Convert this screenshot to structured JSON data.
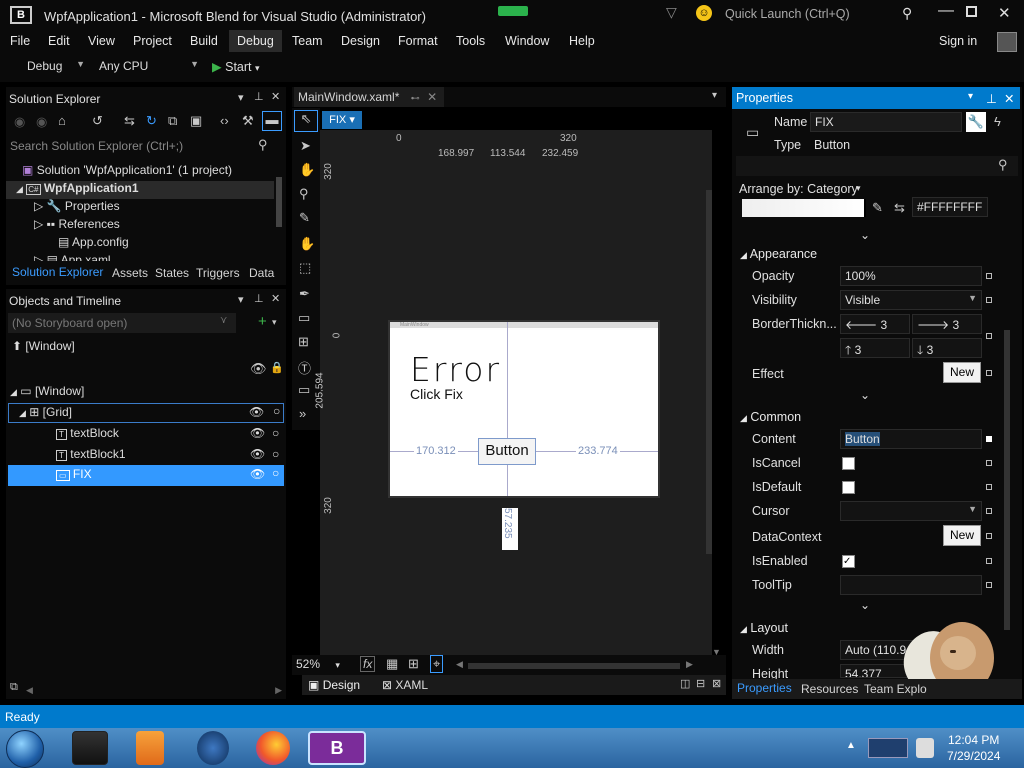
{
  "window": {
    "title": "WpfApplication1 - Microsoft Blend for Visual Studio (Administrator)",
    "quick_launch": "Quick Launch (Ctrl+Q)"
  },
  "menu": {
    "items": [
      "File",
      "Edit",
      "View",
      "Project",
      "Build",
      "Debug",
      "Team",
      "Design",
      "Format",
      "Tools",
      "Window",
      "Help"
    ],
    "sign_in": "Sign in"
  },
  "toolbar": {
    "config": "Debug",
    "platform": "Any CPU",
    "start": "Start"
  },
  "solution_explorer": {
    "title": "Solution Explorer",
    "search_placeholder": "Search Solution Explorer (Ctrl+;)",
    "items": [
      "Solution 'WpfApplication1' (1 project)",
      "WpfApplication1",
      "Properties",
      "References",
      "App.config",
      "App.xaml"
    ],
    "tabs": [
      "Solution Explorer",
      "Assets",
      "States",
      "Triggers",
      "Data"
    ]
  },
  "objects": {
    "title": "Objects and Timeline",
    "storyboard": "(No Storyboard open)",
    "window_root": "[Window]",
    "tree": [
      "[Window]",
      "[Grid]",
      "textBlock",
      "textBlock1",
      "FIX"
    ]
  },
  "document": {
    "tab": "MainWindow.xaml*",
    "fix_badge": "FIX",
    "ruler_top": [
      "0",
      "320"
    ],
    "ruler_left": [
      "320",
      "0",
      "320"
    ],
    "measures": {
      "m1": "168.997",
      "m2": "113.544",
      "m3": "232.459",
      "left": "170.312",
      "right": "233.774",
      "top": "205.594",
      "bottom": "57.235"
    },
    "canvas": {
      "window_label": "MainWindow",
      "error": "Error",
      "click_fix": "Click Fix",
      "button": "Button"
    },
    "zoom": "52%",
    "bottom_tabs": [
      "Design",
      "XAML"
    ]
  },
  "properties": {
    "title": "Properties",
    "name_label": "Name",
    "name_value": "FIX",
    "type_label": "Type",
    "type_value": "Button",
    "arrange": "Arrange by: Category",
    "color_hex": "#FFFFFFFF",
    "appearance": {
      "title": "Appearance",
      "opacity_label": "Opacity",
      "opacity": "100%",
      "visibility_label": "Visibility",
      "visibility": "Visible",
      "border_label": "BorderThickn...",
      "b1": "3",
      "b2": "3",
      "b3": "3",
      "b4": "3",
      "effect_label": "Effect",
      "new": "New"
    },
    "common": {
      "title": "Common",
      "content_label": "Content",
      "content": "Button",
      "iscancel": "IsCancel",
      "isdefault": "IsDefault",
      "cursor": "Cursor",
      "datacontext": "DataContext",
      "new": "New",
      "isenabled": "IsEnabled",
      "tooltip": "ToolTip"
    },
    "layout": {
      "title": "Layout",
      "width_label": "Width",
      "width": "Auto (110.9",
      "height_label": "Height",
      "height": "54.377"
    },
    "tabs": [
      "Properties",
      "Resources",
      "Team Explo"
    ]
  },
  "status": {
    "text": "Ready"
  },
  "taskbar": {
    "time": "12:04 PM",
    "date": "7/29/2024"
  }
}
